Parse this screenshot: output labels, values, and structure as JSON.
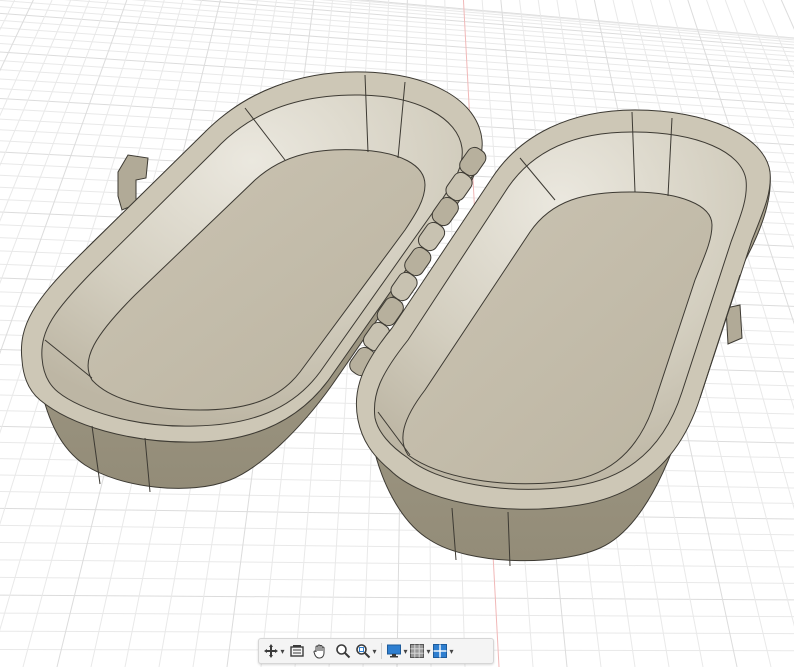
{
  "colors": {
    "background": "#ffffff",
    "grid_minor": "#e9e9e9",
    "grid_major": "#dcdcdc",
    "grid_axis_red": "#f1b8b8",
    "model_outer": "#b5ae9c",
    "model_rim": "#cfc9b8",
    "model_inner_wall": "#d6d1c3",
    "model_floor": "#c4bcaa",
    "model_edge": "#3d3a33",
    "toolbar_bg": "#f4f4f4",
    "icon_dark": "#3a3a3a",
    "icon_blue": "#2f7fd0"
  },
  "navigation_toolbar": {
    "buttons": [
      {
        "icon": "orbit-icon",
        "has_dropdown": true
      },
      {
        "icon": "look-at-icon",
        "has_dropdown": false
      },
      {
        "icon": "pan-hand-icon",
        "has_dropdown": false
      },
      {
        "icon": "zoom-icon",
        "has_dropdown": false
      },
      {
        "icon": "zoom-window-icon",
        "has_dropdown": true
      },
      {
        "icon": "display-settings-icon",
        "has_dropdown": true
      },
      {
        "icon": "grid-settings-icon",
        "has_dropdown": true
      },
      {
        "icon": "viewports-icon",
        "has_dropdown": true
      }
    ]
  }
}
